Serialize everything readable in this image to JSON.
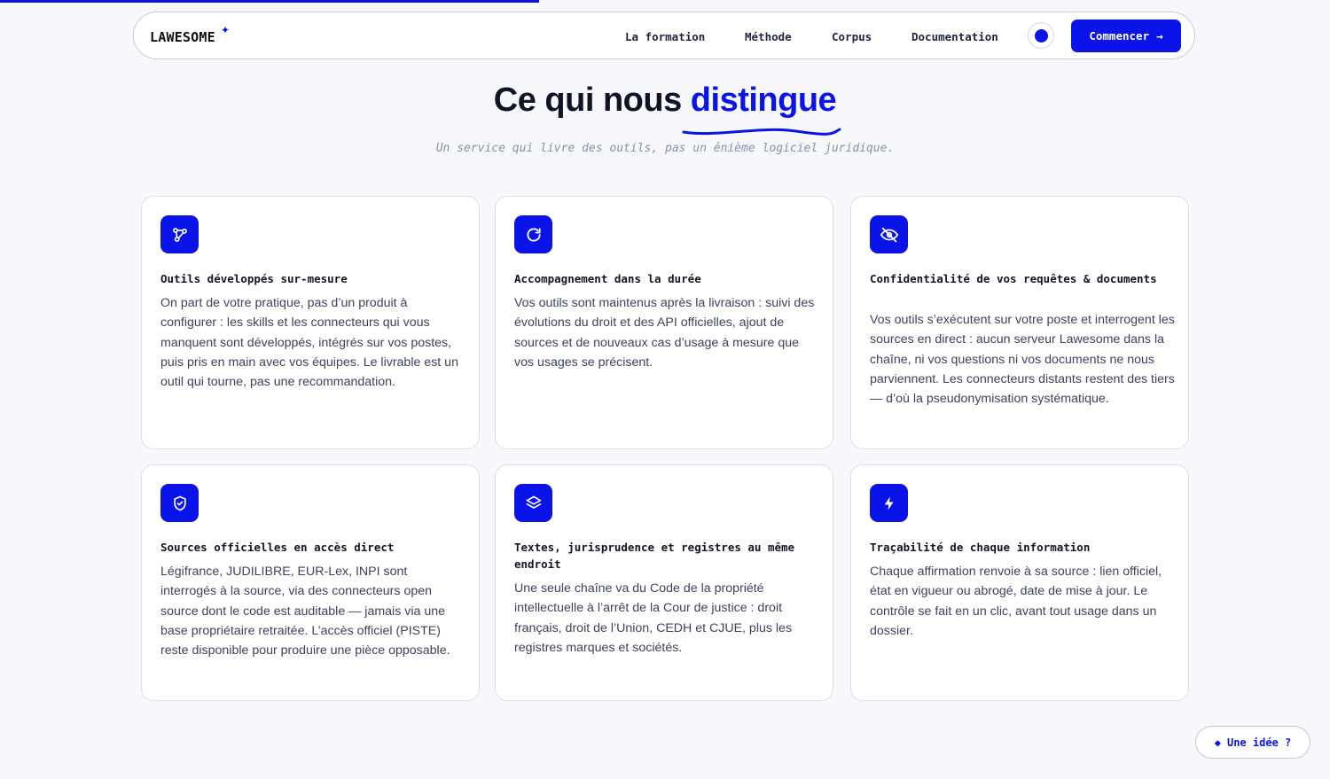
{
  "header": {
    "reading_progress": 0.405,
    "brand": "LAWESOME",
    "brand_mark": "✦",
    "nav": [
      {
        "label": "La formation"
      },
      {
        "label": "Méthode"
      },
      {
        "label": "Corpus"
      },
      {
        "label": "Documentation"
      }
    ],
    "cta_label": "Commencer",
    "cta_arrow": "→"
  },
  "section": {
    "title_prefix": "Ce qui nous ",
    "title_accent": "distingue",
    "subtitle": "Un service qui livre des outils, pas un énième logiciel juridique."
  },
  "features": [
    {
      "icon": "git-branch-icon",
      "title": "Outils développés sur-mesure",
      "body": "On part de votre pratique, pas d’un produit à configurer : les skills et les connecteurs qui vous manquent sont développés, intégrés sur vos postes, puis pris en main avec vos équipes. Le livrable est un outil qui tourne, pas une recommandation."
    },
    {
      "icon": "refresh-icon",
      "title": "Accompagnement dans la durée",
      "body": "Vos outils sont maintenus après la livraison : suivi des évolutions du droit et des API officielles, ajout de sources et de nouveaux cas d’usage à mesure que vos usages se précisent."
    },
    {
      "icon": "eye-off-icon",
      "title": "Confidentialité de vos requêtes & documents",
      "body": "Vos outils s’exécutent sur votre poste et interrogent les sources en direct : aucun serveur Lawesome dans la chaîne, ni vos questions ni vos documents ne nous parviennent. Les connecteurs distants restent des tiers — d’où la pseudonymisation systématique."
    },
    {
      "icon": "shield-check-icon",
      "title": "Sources officielles en accès direct",
      "body": "Légifrance, JUDILIBRE, EUR-Lex, INPI sont interrogés à la source, via des connecteurs open source dont le code est auditable — jamais via une base propriétaire retraitée. L’accès officiel (PISTE) reste disponible pour produire une pièce opposable."
    },
    {
      "icon": "layers-icon",
      "title": "Textes, jurisprudence et registres au même endroit",
      "body": "Une seule chaîne va du Code de la propriété intellectuelle à l’arrêt de la Cour de justice : droit français, droit de l’Union, CEDH et CJUE, plus les registres marques et sociétés."
    },
    {
      "icon": "lightning-icon",
      "title": "Traçabilité de chaque information",
      "body": "Chaque affirmation renvoie à sa source : lien officiel, état en vigueur ou abrogé, date de mise à jour. Le contrôle se fait en un clic, avant tout usage dans un dossier."
    }
  ],
  "feedback": {
    "label": "Une idée ?",
    "icon": "diamond-icon"
  },
  "colors": {
    "accent": "#0a14e8",
    "background": "#f7f8fc",
    "card_border": "#dcdee8",
    "text": "#141428",
    "muted": "#8c90a8"
  }
}
